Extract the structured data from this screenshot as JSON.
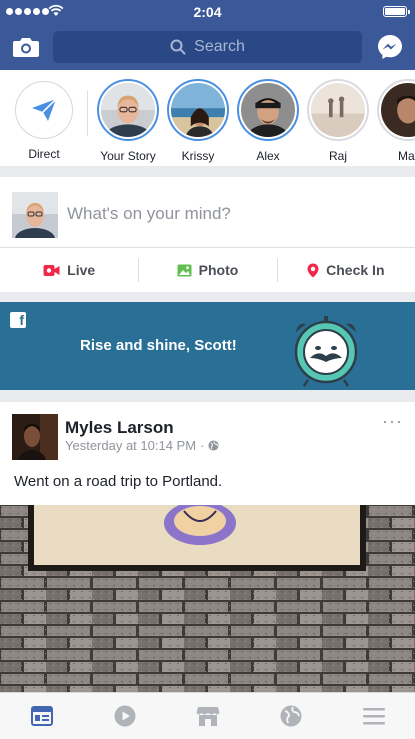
{
  "status_bar": {
    "time": "2:04"
  },
  "navbar": {
    "search_placeholder": "Search"
  },
  "stories": [
    {
      "label": "Direct"
    },
    {
      "label": "Your Story"
    },
    {
      "label": "Krissy"
    },
    {
      "label": "Alex"
    },
    {
      "label": "Raj"
    },
    {
      "label": "Mat"
    }
  ],
  "composer": {
    "prompt": "What's on your mind?",
    "actions": {
      "live": "Live",
      "photo": "Photo",
      "checkin": "Check In"
    }
  },
  "banner": {
    "message": "Rise and shine, Scott!",
    "logo": "f"
  },
  "post": {
    "author": "Myles Larson",
    "timestamp": "Yesterday at 10:14 PM",
    "separator": "·",
    "text": "Went on a road trip to Portland.",
    "more": "···"
  },
  "colors": {
    "brand": "#3b5998",
    "banner": "#2a6f95",
    "active_tab": "#4267b2"
  }
}
